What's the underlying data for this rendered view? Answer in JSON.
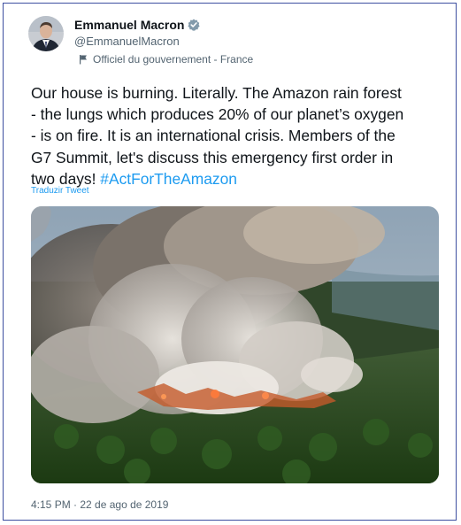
{
  "author": {
    "name": "Emmanuel Macron",
    "handle": "@EmmanuelMacron",
    "affiliation": "Officiel du gouvernement - France",
    "verified_color": "#829aab"
  },
  "tweet": {
    "text": "Our house is burning. Literally. The Amazon rain forest\n- the lungs which produces 20% of our planet’s oxygen\n- is on fire. It is an international crisis. Members of the\nG7 Summit, let's discuss this emergency first order in\ntwo days! ",
    "hashtag": "#ActForTheAmazon",
    "translate_label": "Traduzir Tweet",
    "timestamp": "4:15 PM · 22 de ago de 2019"
  },
  "colors": {
    "link": "#1d9bf0",
    "frame_border": "#3d4fa0"
  },
  "icons": {
    "verified": "verified-badge-icon",
    "government": "flag-icon"
  }
}
